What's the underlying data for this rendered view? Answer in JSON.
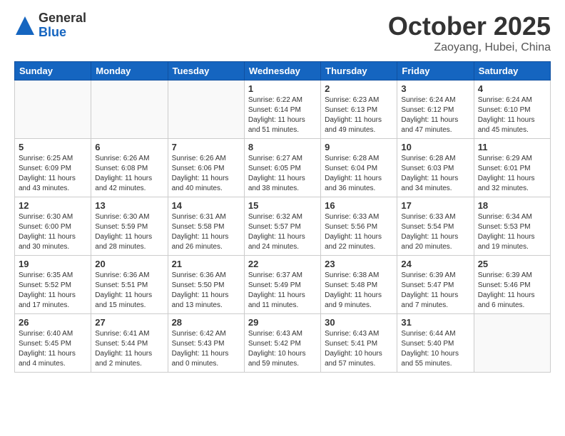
{
  "header": {
    "logo_general": "General",
    "logo_blue": "Blue",
    "month_title": "October 2025",
    "location": "Zaoyang, Hubei, China"
  },
  "days_of_week": [
    "Sunday",
    "Monday",
    "Tuesday",
    "Wednesday",
    "Thursday",
    "Friday",
    "Saturday"
  ],
  "weeks": [
    [
      {
        "day": "",
        "info": ""
      },
      {
        "day": "",
        "info": ""
      },
      {
        "day": "",
        "info": ""
      },
      {
        "day": "1",
        "info": "Sunrise: 6:22 AM\nSunset: 6:14 PM\nDaylight: 11 hours\nand 51 minutes."
      },
      {
        "day": "2",
        "info": "Sunrise: 6:23 AM\nSunset: 6:13 PM\nDaylight: 11 hours\nand 49 minutes."
      },
      {
        "day": "3",
        "info": "Sunrise: 6:24 AM\nSunset: 6:12 PM\nDaylight: 11 hours\nand 47 minutes."
      },
      {
        "day": "4",
        "info": "Sunrise: 6:24 AM\nSunset: 6:10 PM\nDaylight: 11 hours\nand 45 minutes."
      }
    ],
    [
      {
        "day": "5",
        "info": "Sunrise: 6:25 AM\nSunset: 6:09 PM\nDaylight: 11 hours\nand 43 minutes."
      },
      {
        "day": "6",
        "info": "Sunrise: 6:26 AM\nSunset: 6:08 PM\nDaylight: 11 hours\nand 42 minutes."
      },
      {
        "day": "7",
        "info": "Sunrise: 6:26 AM\nSunset: 6:06 PM\nDaylight: 11 hours\nand 40 minutes."
      },
      {
        "day": "8",
        "info": "Sunrise: 6:27 AM\nSunset: 6:05 PM\nDaylight: 11 hours\nand 38 minutes."
      },
      {
        "day": "9",
        "info": "Sunrise: 6:28 AM\nSunset: 6:04 PM\nDaylight: 11 hours\nand 36 minutes."
      },
      {
        "day": "10",
        "info": "Sunrise: 6:28 AM\nSunset: 6:03 PM\nDaylight: 11 hours\nand 34 minutes."
      },
      {
        "day": "11",
        "info": "Sunrise: 6:29 AM\nSunset: 6:01 PM\nDaylight: 11 hours\nand 32 minutes."
      }
    ],
    [
      {
        "day": "12",
        "info": "Sunrise: 6:30 AM\nSunset: 6:00 PM\nDaylight: 11 hours\nand 30 minutes."
      },
      {
        "day": "13",
        "info": "Sunrise: 6:30 AM\nSunset: 5:59 PM\nDaylight: 11 hours\nand 28 minutes."
      },
      {
        "day": "14",
        "info": "Sunrise: 6:31 AM\nSunset: 5:58 PM\nDaylight: 11 hours\nand 26 minutes."
      },
      {
        "day": "15",
        "info": "Sunrise: 6:32 AM\nSunset: 5:57 PM\nDaylight: 11 hours\nand 24 minutes."
      },
      {
        "day": "16",
        "info": "Sunrise: 6:33 AM\nSunset: 5:56 PM\nDaylight: 11 hours\nand 22 minutes."
      },
      {
        "day": "17",
        "info": "Sunrise: 6:33 AM\nSunset: 5:54 PM\nDaylight: 11 hours\nand 20 minutes."
      },
      {
        "day": "18",
        "info": "Sunrise: 6:34 AM\nSunset: 5:53 PM\nDaylight: 11 hours\nand 19 minutes."
      }
    ],
    [
      {
        "day": "19",
        "info": "Sunrise: 6:35 AM\nSunset: 5:52 PM\nDaylight: 11 hours\nand 17 minutes."
      },
      {
        "day": "20",
        "info": "Sunrise: 6:36 AM\nSunset: 5:51 PM\nDaylight: 11 hours\nand 15 minutes."
      },
      {
        "day": "21",
        "info": "Sunrise: 6:36 AM\nSunset: 5:50 PM\nDaylight: 11 hours\nand 13 minutes."
      },
      {
        "day": "22",
        "info": "Sunrise: 6:37 AM\nSunset: 5:49 PM\nDaylight: 11 hours\nand 11 minutes."
      },
      {
        "day": "23",
        "info": "Sunrise: 6:38 AM\nSunset: 5:48 PM\nDaylight: 11 hours\nand 9 minutes."
      },
      {
        "day": "24",
        "info": "Sunrise: 6:39 AM\nSunset: 5:47 PM\nDaylight: 11 hours\nand 7 minutes."
      },
      {
        "day": "25",
        "info": "Sunrise: 6:39 AM\nSunset: 5:46 PM\nDaylight: 11 hours\nand 6 minutes."
      }
    ],
    [
      {
        "day": "26",
        "info": "Sunrise: 6:40 AM\nSunset: 5:45 PM\nDaylight: 11 hours\nand 4 minutes."
      },
      {
        "day": "27",
        "info": "Sunrise: 6:41 AM\nSunset: 5:44 PM\nDaylight: 11 hours\nand 2 minutes."
      },
      {
        "day": "28",
        "info": "Sunrise: 6:42 AM\nSunset: 5:43 PM\nDaylight: 11 hours\nand 0 minutes."
      },
      {
        "day": "29",
        "info": "Sunrise: 6:43 AM\nSunset: 5:42 PM\nDaylight: 10 hours\nand 59 minutes."
      },
      {
        "day": "30",
        "info": "Sunrise: 6:43 AM\nSunset: 5:41 PM\nDaylight: 10 hours\nand 57 minutes."
      },
      {
        "day": "31",
        "info": "Sunrise: 6:44 AM\nSunset: 5:40 PM\nDaylight: 10 hours\nand 55 minutes."
      },
      {
        "day": "",
        "info": ""
      }
    ]
  ]
}
